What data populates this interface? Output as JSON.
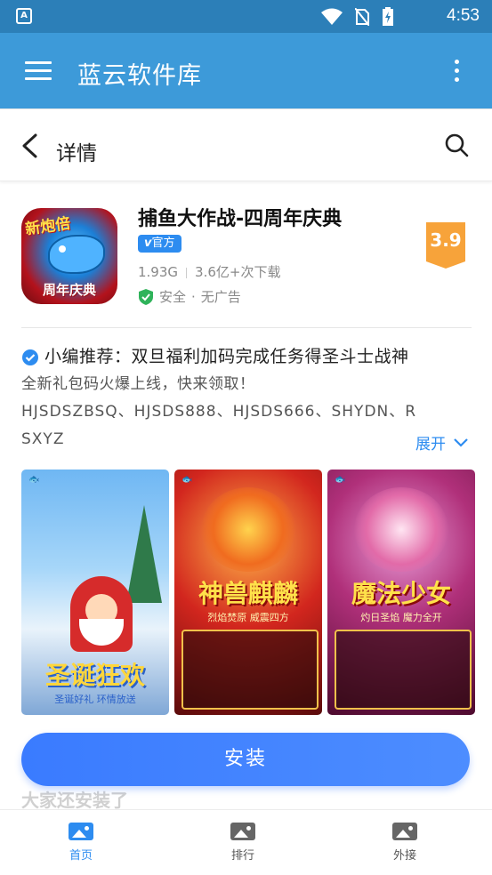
{
  "status_bar": {
    "time": "4:53"
  },
  "app_bar": {
    "title": "蓝云软件库"
  },
  "sub_header": {
    "title": "详情"
  },
  "app": {
    "name": "捕鱼大作战-四周年庆典",
    "badge": "官方",
    "size": "1.93G",
    "downloads": "3.6亿+次下载",
    "safe": "安全",
    "no_ads": "无广告",
    "rating": "3.9",
    "icon_text_top": "新炮倍",
    "icon_text_bottom": "周年庆典"
  },
  "recommend": {
    "line1": "小编推荐：双旦福利加码完成任务得圣斗士战神",
    "line2": "全新礼包码火爆上线，快来领取！",
    "line3": "HJSDSZBSQ、HJSDS888、HJSDS666、SHYDN、R",
    "line4": "SXYZ",
    "expand": "展开"
  },
  "screenshots": [
    {
      "banner": "圣诞狂欢",
      "sub": "圣诞好礼 环情放送"
    },
    {
      "banner": "神兽麒麟",
      "sub": "烈焰焚原 威震四方"
    },
    {
      "banner": "魔法少女",
      "sub": "灼日圣焰 魔力全开"
    }
  ],
  "install_button": "安装",
  "below_section": "大家还安装了",
  "tabs": [
    {
      "label": "首页",
      "active": true
    },
    {
      "label": "排行",
      "active": false
    },
    {
      "label": "外接",
      "active": false
    }
  ],
  "colors": {
    "app_bar": "#3d9ad9",
    "accent": "#2d8cf0",
    "rating": "#f7a33a",
    "install": "#3a7bff"
  }
}
